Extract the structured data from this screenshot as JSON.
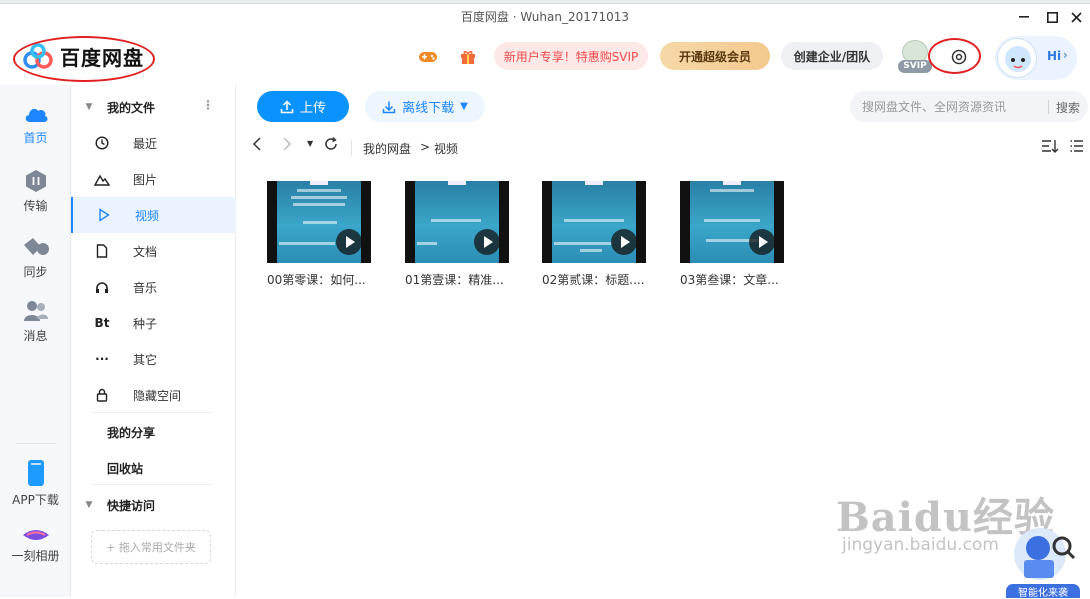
{
  "window": {
    "title": "百度网盘 · Wuhan_20171013"
  },
  "header": {
    "logo_text": "百度网盘",
    "promo_label": "新用户专享！特惠购SVIP",
    "super_member_label": "开通超级会员",
    "enterprise_label": "创建企业/团队",
    "svip_badge": "SVIP",
    "hi_label": "Hi",
    "brand_color": "#0a92ff"
  },
  "rail": {
    "items": [
      {
        "label": "首页",
        "icon": "cloud-icon"
      },
      {
        "label": "传输",
        "icon": "transfer-icon"
      },
      {
        "label": "同步",
        "icon": "sync-icon"
      },
      {
        "label": "消息",
        "icon": "messages-icon"
      },
      {
        "label": "APP下载",
        "icon": "phone-icon"
      },
      {
        "label": "一刻相册",
        "icon": "album-icon"
      }
    ]
  },
  "tree": {
    "my_files": "我的文件",
    "items": [
      {
        "label": "最近",
        "icon": "clock-icon"
      },
      {
        "label": "图片",
        "icon": "image-icon"
      },
      {
        "label": "视频",
        "icon": "play-icon"
      },
      {
        "label": "文档",
        "icon": "doc-icon"
      },
      {
        "label": "音乐",
        "icon": "headphones-icon"
      },
      {
        "label": "种子",
        "icon": "bt-icon",
        "glyph": "Bt"
      },
      {
        "label": "其它",
        "icon": "more-icon",
        "glyph": "···"
      },
      {
        "label": "隐藏空间",
        "icon": "lock-icon"
      }
    ],
    "my_share": "我的分享",
    "recycle": "回收站",
    "quick_access": "快捷访问",
    "add_folder": "+ 拖入常用文件夹"
  },
  "toolbar": {
    "upload_label": "上传",
    "offline_label": "离线下载",
    "search_placeholder": "搜网盘文件、全网资源资讯",
    "search_button": "搜索"
  },
  "breadcrumb": {
    "root": "我的网盘",
    "separator": ">",
    "current": "视频"
  },
  "files": [
    {
      "name": "00第零课：如何..."
    },
    {
      "name": "01第壹课：精准..."
    },
    {
      "name": "02第贰课：标题...."
    },
    {
      "name": "03第叁课：文章..."
    }
  ],
  "watermark": {
    "brand": "Baidu经验",
    "url": "jingyan.baidu.com",
    "robot_label": "智能化来袭"
  }
}
